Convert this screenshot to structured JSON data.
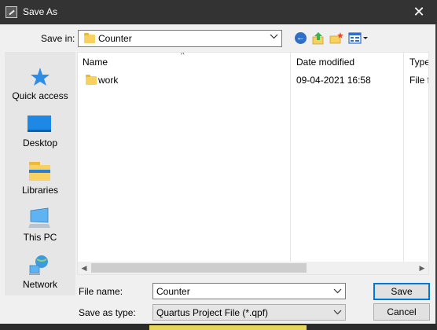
{
  "window": {
    "title": "Save As",
    "close_glyph": "✕"
  },
  "toolbar": {
    "save_in_label": "Save in:",
    "save_in_value": "Counter",
    "back_icon": "back-arrow-icon",
    "up_icon": "up-folder-icon",
    "new_folder_icon": "new-folder-icon",
    "views_icon": "view-menu-icon"
  },
  "places": [
    {
      "label": "Quick access",
      "icon": "star-icon"
    },
    {
      "label": "Desktop",
      "icon": "desktop-icon"
    },
    {
      "label": "Libraries",
      "icon": "libraries-icon"
    },
    {
      "label": "This PC",
      "icon": "computer-icon"
    },
    {
      "label": "Network",
      "icon": "network-icon"
    }
  ],
  "columns": {
    "name": "Name",
    "date": "Date modified",
    "type": "Type"
  },
  "files": [
    {
      "name": "work",
      "date": "09-04-2021 16:58",
      "type": "File fo"
    }
  ],
  "form": {
    "file_name_label": "File name:",
    "file_name_value": "Counter",
    "type_label": "Save as type:",
    "type_value": "Quartus Project File (*.qpf)"
  },
  "buttons": {
    "save": "Save",
    "cancel": "Cancel"
  },
  "colors": {
    "titlebar": "#333333",
    "accent": "#0078d7",
    "folder": "#f7d260"
  }
}
